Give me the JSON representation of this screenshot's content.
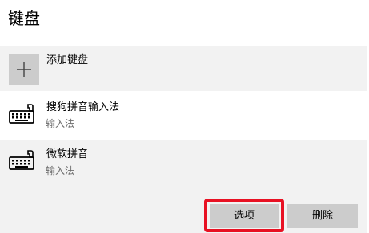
{
  "section": {
    "title": "键盘"
  },
  "add_keyboard": {
    "label": "添加键盘",
    "icon": "plus-icon"
  },
  "keyboards": [
    {
      "name": "搜狗拼音输入法",
      "subtitle": "输入法",
      "icon": "keyboard-icon"
    },
    {
      "name": "微软拼音",
      "subtitle": "输入法",
      "icon": "keyboard-icon"
    }
  ],
  "actions": {
    "options_label": "选项",
    "remove_label": "删除"
  },
  "colors": {
    "row_background": "#f2f2f2",
    "button_background": "#cccccc",
    "subtitle": "#6d6d6d",
    "highlight": "#e81123"
  }
}
